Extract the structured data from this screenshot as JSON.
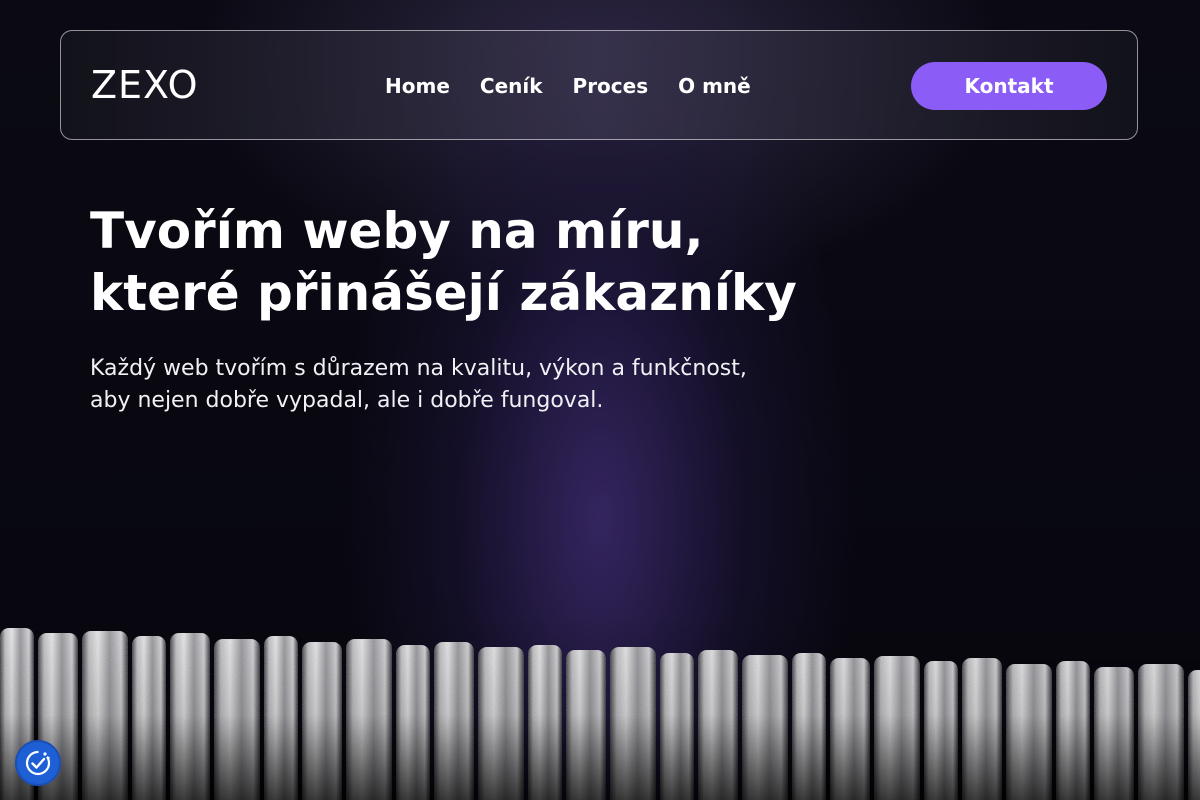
{
  "header": {
    "logo": "ZEXO",
    "nav": [
      {
        "label": "Home"
      },
      {
        "label": "Ceník"
      },
      {
        "label": "Proces"
      },
      {
        "label": "O mně"
      }
    ],
    "cta_label": "Kontakt"
  },
  "hero": {
    "title_lines": [
      "Tvořím weby na míru,",
      "které přinášejí zákazníky"
    ],
    "subtitle_lines": [
      "Každý web tvořím s důrazem na kvalitu, výkon a funkčnost,",
      "aby nejen dobře vypadal, ale i dobře fungoval."
    ]
  },
  "colors": {
    "accent": "#8b5cf6",
    "background": "#07060e",
    "consent_badge": "#1f5fd6"
  },
  "icons": {
    "consent": "cookie-consent-check-icon"
  }
}
